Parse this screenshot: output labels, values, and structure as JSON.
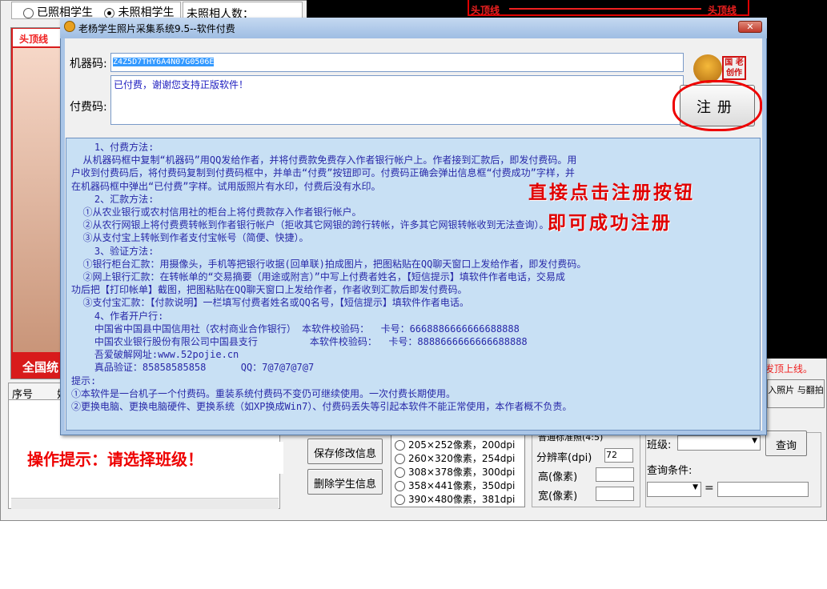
{
  "background": {
    "radio_shot": "已照相学生",
    "radio_not_shot": "未照相学生",
    "count_label": "未照相人数：",
    "headline_left": "头顶线",
    "headline_right": "头顶线",
    "photo_headline": "头顶线",
    "photo_banner": "全国统",
    "list_col_no": "序号",
    "list_col_2": "姓",
    "hint": "操作提示：请选择班级！",
    "btn_save": "保存修改信息",
    "btn_delete": "删除学生信息",
    "sizes": [
      "205×252像素，200dpi",
      "260×320像素，254dpi",
      "308×378像素，300dpi",
      "358×441像素，350dpi",
      "390×480像素，381dpi"
    ],
    "std_check": "普通标准照(4:5)",
    "dpi_label": "分辨率(dpi)",
    "dpi_value": "72",
    "height_label": "高(像素)",
    "width_label": "宽(像素)",
    "class_label": "班级:",
    "query_button": "查询",
    "query_cond": "查询条件:",
    "equals": "=",
    "right_red": "发顶上线。",
    "right_btn": "入照片 与翻拍"
  },
  "dialog": {
    "title": "老杨学生照片采集系统9.5--软件付费",
    "close": "✕",
    "machine_label": "机器码:",
    "machine_code": "Z4Z5D7THY6A4N07G0506E",
    "pay_label": "付费码:",
    "pay_code": "已付费，谢谢您支持正版软件！",
    "stamp_text": "国 老 创作",
    "register_button": "注册",
    "info_lines": [
      "    1、付费方法:",
      "  从机器码框中复制“机器码”用QQ发给作者，并将付费款免费存入作者银行帐户上。作者接到汇款后，即发付费码。用",
      "户收到付费码后，将付费码复制到付费码框中，并单击“付费”按钮即可。付费码正确会弹出信息框“付费成功”字样，并",
      "在机器码框中弹出“已付费”字样。试用版照片有水印，付费后没有水印。",
      "    2、汇款方法:",
      "  ①从农业银行或农村信用社的柜台上将付费款存入作者银行帐户。",
      "  ②从农行网银上将付费费转帐到作者银行帐户（拒收其它网银的跨行转帐，许多其它网银转帐收到无法查询）。",
      "  ③从支付宝上转帐到作者支付宝帐号（简便、快捷）。",
      "    3、验证方法:",
      "  ①银行柜台汇款：用摄像头，手机等把银行收据(回单联)拍成图片，把图粘贴在QQ聊天窗口上发给作者，即发付费码。",
      "  ②网上银行汇款：在转帐单的“交易摘要（用途或附言）”中写上付费者姓名，【短信提示】填软件作者电话，交易成",
      "功后把【打印帐单】截图，把图粘贴在QQ聊天窗口上发给作者，作者收到汇款后即发付费码。",
      "  ③支付宝汇款：【付款说明】一栏填写付费者姓名或QQ名号，【短信提示】填软件作者电话。",
      "    4、作者开户行:",
      "    中国省中国县中国信用社（农村商业合作银行） 本软件校验码：  卡号：6668886666666688888",
      "    中国农业银行股份有限公司中国县支行         本软件校验码：  卡号：8888666666666688888",
      "    吾爱破解网址:www.52pojie.cn",
      "    真品验证：85858585858      QQ：7@7@7@7@7",
      "",
      "提示:",
      "①本软件是一台机子一个付费码。重装系统付费码不变仍可继续使用。一次付费长期使用。",
      "②更换电脑、更换电脑硬件、更换系统（如XP换成Win7）、付费码丢失等引起本软件不能正常使用，本作者概不负责。"
    ],
    "overlay_line1": "直接点击注册按钮",
    "overlay_line2": "即可成功注册"
  }
}
